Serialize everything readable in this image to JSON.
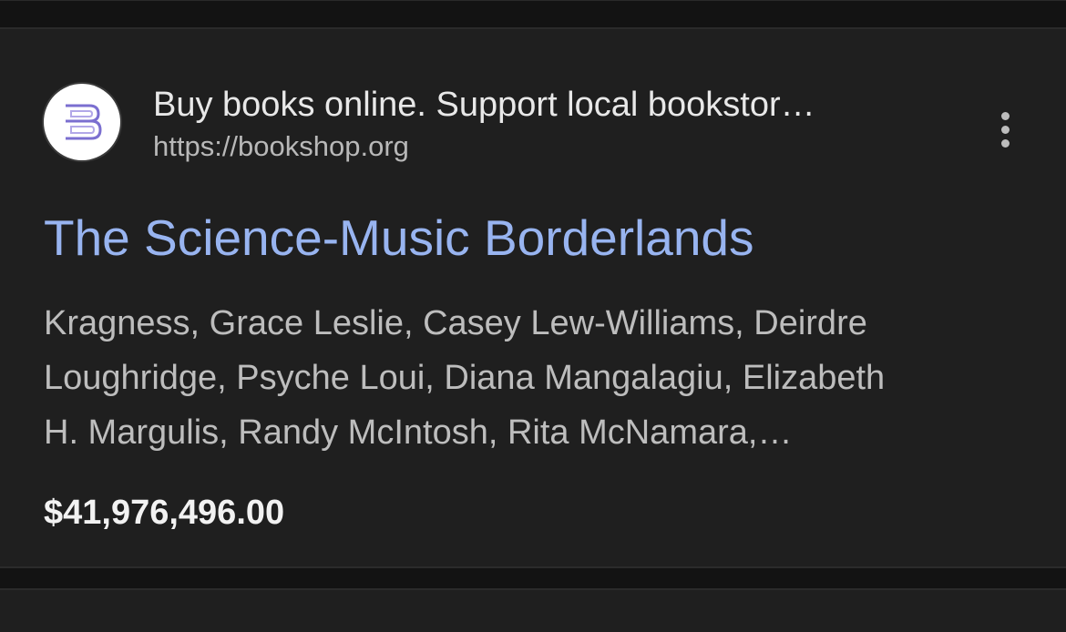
{
  "result": {
    "favicon_icon": "bookshop-b-logo-icon",
    "site_name": "Buy books online. Support local bookstor…",
    "site_url": "https://bookshop.org",
    "more_icon": "more-vertical-icon",
    "title": "The Science-Music Borderlands",
    "snippet_lines": [
      "Kragness, Grace Leslie, Casey Lew-Williams, Deirdre",
      "Loughridge, Psyche Loui, Diana Mangalagiu, Elizabeth",
      "H. Margulis, Randy McIntosh, Rita McNamara,…"
    ],
    "price": "$41,976,496.00"
  },
  "colors": {
    "background": "#1f1f1f",
    "separator": "#131313",
    "title_link": "#98b4f0",
    "site_name": "#e8e8e8",
    "url": "#b8b8b8",
    "snippet": "#bdbdbd",
    "price": "#f2f2f2",
    "favicon_letter": "#7b6fd0"
  }
}
